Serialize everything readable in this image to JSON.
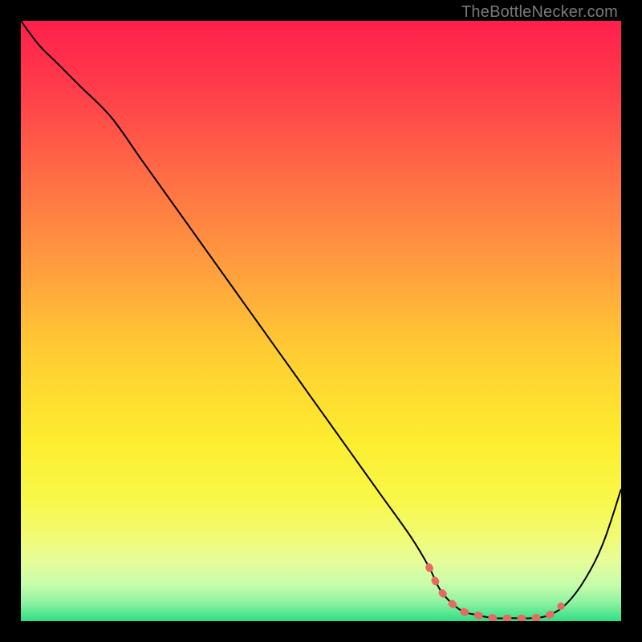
{
  "watermark": "TheBottleNecker.com",
  "chart_data": {
    "type": "line",
    "title": "",
    "xlabel": "",
    "ylabel": "",
    "xlim": [
      0,
      100
    ],
    "ylim": [
      0,
      100
    ],
    "grid": false,
    "series": [
      {
        "name": "bottleneck-curve",
        "x": [
          0,
          3,
          6,
          10,
          15,
          20,
          25,
          30,
          35,
          40,
          45,
          50,
          55,
          60,
          65,
          68,
          70,
          73,
          76,
          79,
          82,
          85,
          88,
          91,
          94,
          97,
          100
        ],
        "values": [
          100,
          96,
          93,
          89,
          84,
          77,
          70,
          63,
          56,
          49,
          42,
          35,
          28,
          21,
          14,
          9,
          5,
          2,
          1,
          0.5,
          0.5,
          0.5,
          1,
          3,
          7,
          13,
          22
        ]
      }
    ],
    "highlight_segment": {
      "name": "sweet-spot",
      "x": [
        68,
        70,
        73,
        76,
        79,
        82,
        85,
        88,
        90
      ],
      "values": [
        9,
        5,
        2,
        1,
        0.5,
        0.5,
        0.5,
        1,
        2.5
      ]
    },
    "background_gradient": {
      "stops": [
        {
          "pos": 0.0,
          "color": "#ff1f4b"
        },
        {
          "pos": 0.12,
          "color": "#ff3f4a"
        },
        {
          "pos": 0.25,
          "color": "#ff6a46"
        },
        {
          "pos": 0.4,
          "color": "#ff9a3f"
        },
        {
          "pos": 0.55,
          "color": "#ffcc33"
        },
        {
          "pos": 0.7,
          "color": "#fded2f"
        },
        {
          "pos": 0.8,
          "color": "#f8f84a"
        },
        {
          "pos": 0.86,
          "color": "#f1fb74"
        },
        {
          "pos": 0.9,
          "color": "#e6fd99"
        },
        {
          "pos": 0.94,
          "color": "#c6fdab"
        },
        {
          "pos": 0.97,
          "color": "#8bf2a0"
        },
        {
          "pos": 1.0,
          "color": "#2fdd85"
        }
      ]
    },
    "curve_color": "#000000",
    "highlight_color": "#e46a62"
  }
}
